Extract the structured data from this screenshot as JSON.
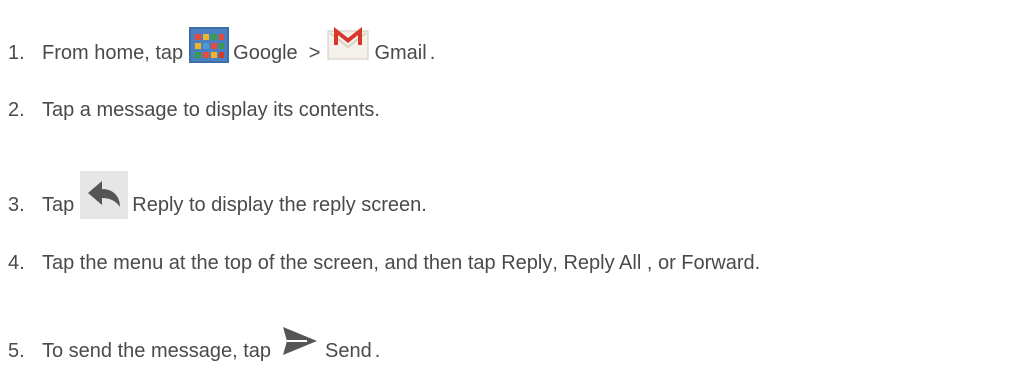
{
  "steps": [
    {
      "number": "1.",
      "text_a": "From home, tap",
      "icon_a": "google-folder-icon",
      "text_b": "Google  >",
      "icon_b": "gmail-icon",
      "text_c": "Gmail",
      "text_d": "."
    },
    {
      "number": "2.",
      "text": "Tap a message to display its contents."
    },
    {
      "number": "3.",
      "text_a": "Tap",
      "icon": "reply-icon",
      "text_b": "Reply to display the reply screen."
    },
    {
      "number": "4.",
      "text_a": "Tap the menu at the top of the screen, and then tap Reply",
      "text_b": ", Reply All",
      "text_c": " , or Forward."
    },
    {
      "number": "5.",
      "text_a": "To send the message, tap",
      "icon": "send-icon",
      "text_b": "Send",
      "text_c": "."
    }
  ],
  "colors": {
    "text": "#4a4a4a",
    "gmail_red": "#d9362b",
    "icon_gray": "#555555",
    "icon_bg": "#e6e6e6"
  }
}
